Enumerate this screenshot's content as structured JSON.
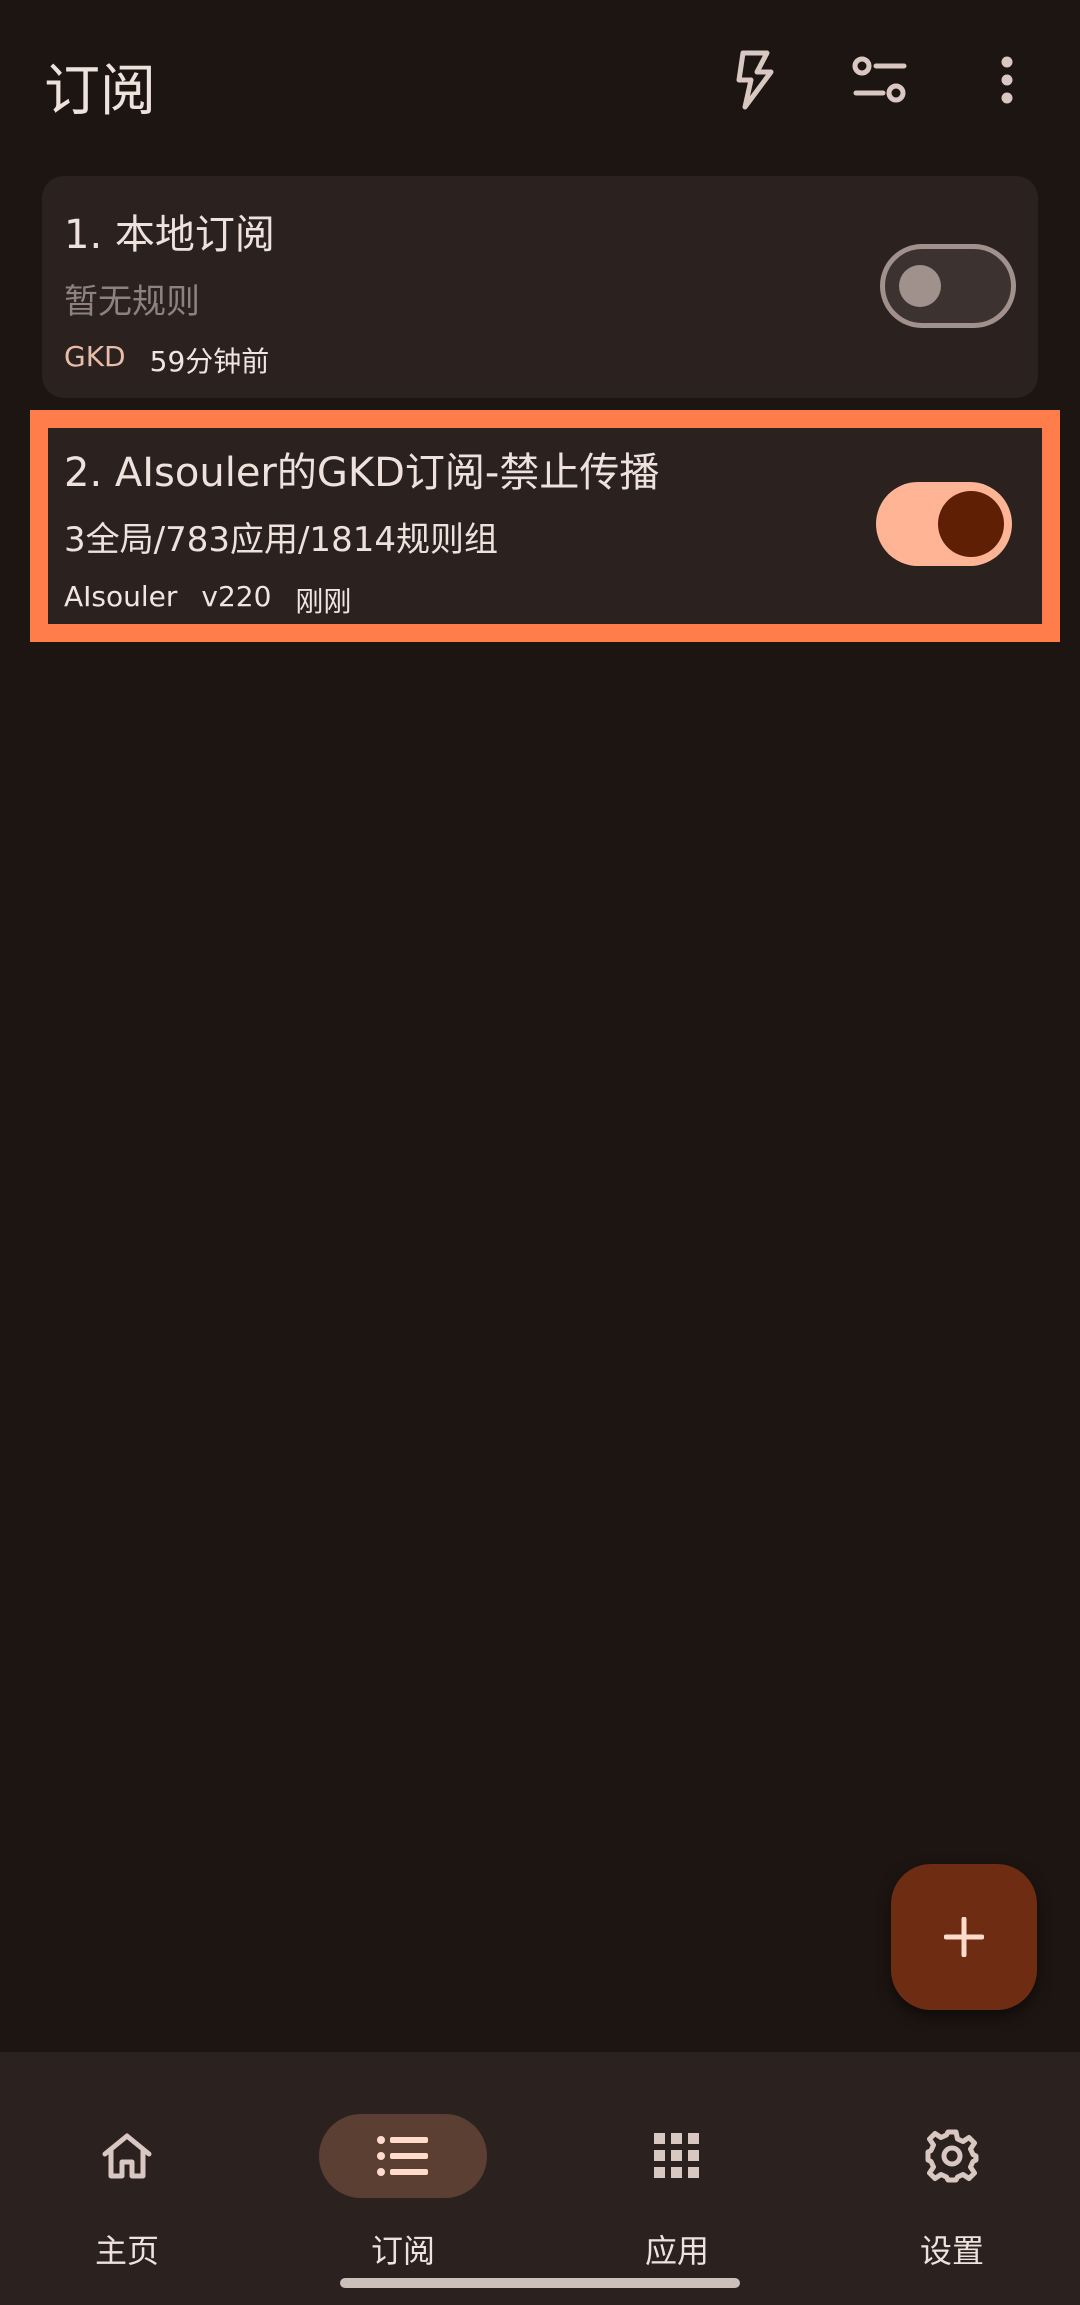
{
  "topbar": {
    "title": "订阅",
    "actions": [
      "flash-icon",
      "tune-icon",
      "more-vert-icon"
    ]
  },
  "subscriptions": [
    {
      "title": "1. 本地订阅",
      "summary": "暂无规则",
      "meta": [
        "GKD",
        "59分钟前"
      ],
      "enabled": false
    },
    {
      "title": "2. AIsouler的GKD订阅-禁止传播",
      "summary": "3全局/783应用/1814规则组",
      "meta": [
        "AIsouler",
        "v220",
        "刚刚"
      ],
      "enabled": true,
      "highlighted": true
    }
  ],
  "fab": {
    "icon": "add-icon"
  },
  "bottom_nav": {
    "items": [
      {
        "label": "主页",
        "icon": "home-icon",
        "active": false
      },
      {
        "label": "订阅",
        "icon": "list-icon",
        "active": true
      },
      {
        "label": "应用",
        "icon": "apps-grid-icon",
        "active": false
      },
      {
        "label": "设置",
        "icon": "settings-icon",
        "active": false
      }
    ]
  },
  "colors": {
    "background": "#1c1512",
    "card": "#2b2220",
    "highlight_border": "#ff7c4b",
    "switch_on_track": "#ffb595",
    "switch_on_thumb": "#5f1f05",
    "fab": "#6e2d12",
    "nav_active_pill": "#5c3f33"
  }
}
